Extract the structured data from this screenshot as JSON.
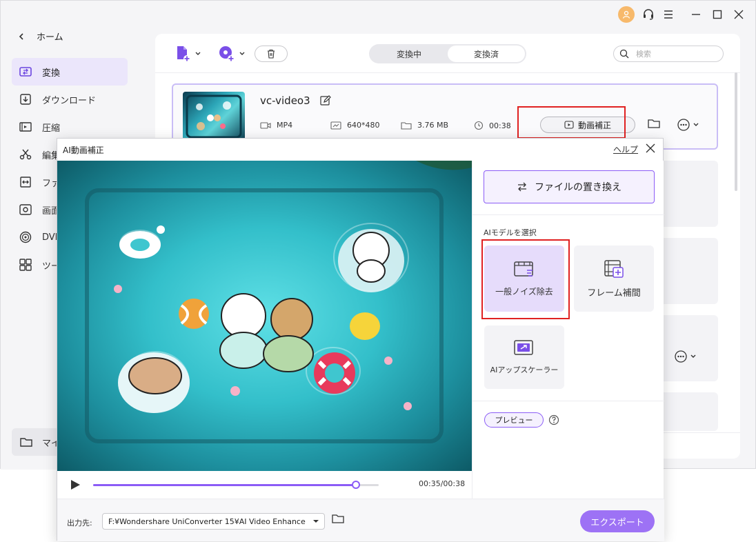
{
  "window": {
    "controls": [
      "avatar-icon",
      "headset-icon",
      "menu-icon",
      "minimize-icon",
      "maximize-icon",
      "close-icon"
    ]
  },
  "sidebar": {
    "back_label": "ホーム",
    "items": [
      {
        "label": "変換",
        "icon": "convert-icon",
        "active": true
      },
      {
        "label": "ダウンロード",
        "icon": "download-icon"
      },
      {
        "label": "圧縮",
        "icon": "compress-icon"
      },
      {
        "label": "編集",
        "icon": "scissors-icon"
      },
      {
        "label": "ファ",
        "icon": "merge-icon"
      },
      {
        "label": "画面",
        "icon": "screen-record-icon"
      },
      {
        "label": "DVI",
        "icon": "dvd-icon"
      },
      {
        "label": "ツー",
        "icon": "toolbox-icon"
      }
    ],
    "myfiles_label": "マイ"
  },
  "toolbar": {
    "tabs": [
      {
        "label": "変換中",
        "active": false
      },
      {
        "label": "変換済",
        "active": true
      }
    ],
    "search_placeholder": "検索"
  },
  "file": {
    "name": "vc-video3",
    "format": "MP4",
    "resolution": "640*480",
    "size": "3.76 MB",
    "duration": "00:38",
    "enhance_label": "動画補正"
  },
  "dialog": {
    "title": "AI動画補正",
    "help_label": "ヘルプ",
    "replace_label": "ファイルの置き換え",
    "model_section_label": "AIモデルを選択",
    "models": [
      {
        "label": "一般ノイズ除去",
        "icon": "denoise-icon",
        "selected": true
      },
      {
        "label": "フレーム補間",
        "icon": "frame-interp-icon",
        "selected": false
      },
      {
        "label": "AIアップスケーラー",
        "icon": "upscale-icon",
        "selected": false
      }
    ],
    "preview_label": "プレビュー",
    "player": {
      "time": "00:35/00:38",
      "progress": 0.92
    },
    "output_label": "出力先:",
    "output_path": "F:¥Wondershare UniConverter 15¥AI Video Enhance",
    "export_label": "エクスポート"
  },
  "colors": {
    "accent": "#8b5cf6",
    "highlight_outline": "#e02020",
    "export_bg": "#9d72f5"
  }
}
